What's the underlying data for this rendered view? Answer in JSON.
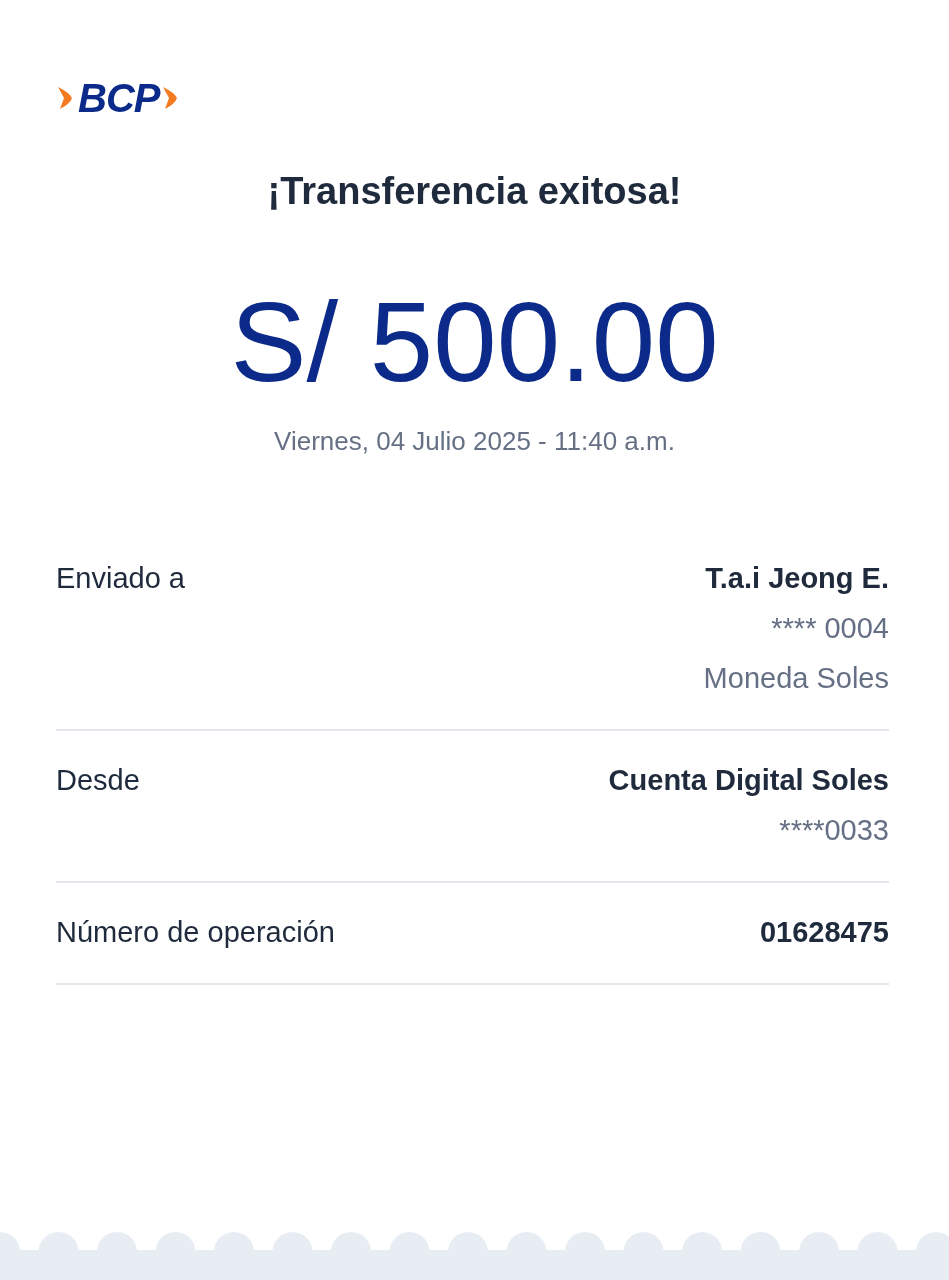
{
  "logo": {
    "text": "BCP"
  },
  "title": "¡Transferencia exitosa!",
  "amount": "S/ 500.00",
  "datetime": "Viernes, 04 Julio 2025 - 11:40 a.m.",
  "details": [
    {
      "label": "Enviado a",
      "values": [
        {
          "kind": "primary",
          "text": "T.a.i Jeong E."
        },
        {
          "kind": "secondary",
          "text": "**** 0004"
        },
        {
          "kind": "secondary",
          "text": "Moneda Soles"
        }
      ]
    },
    {
      "label": "Desde",
      "values": [
        {
          "kind": "primary",
          "text": "Cuenta Digital Soles"
        },
        {
          "kind": "secondary",
          "text": "****0033"
        }
      ]
    },
    {
      "label": "Número de operación",
      "values": [
        {
          "kind": "primary",
          "text": "01628475"
        }
      ]
    }
  ]
}
